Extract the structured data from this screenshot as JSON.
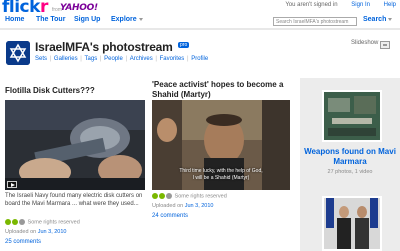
{
  "header": {
    "logo_flick": "flick",
    "logo_r": "r",
    "from": "from",
    "yahoo": "YAHOO!",
    "signin_status": "You aren't signed in",
    "sign_in": "Sign In",
    "help": "Help"
  },
  "nav": {
    "home": "Home",
    "tour": "The Tour",
    "signup": "Sign Up",
    "explore": "Explore",
    "search_placeholder": "Search IsraelMFA's photostream",
    "search": "Search"
  },
  "profile": {
    "title": "IsraelMFA's photostream",
    "pro_badge": "pro",
    "subnav": [
      "Sets",
      "Galleries",
      "Tags",
      "People",
      "Archives",
      "Favorites",
      "Profile"
    ],
    "slideshow": "Slideshow"
  },
  "posts": [
    {
      "title": "Flotilla Disk Cutters???",
      "caption": "The Israeli Navy found many electric disk cutters on board the Mavi Marmara ... what were they used...",
      "rights": "Some rights reserved",
      "uploaded_prefix": "Uploaded on",
      "uploaded_date": "Jun 3, 2010",
      "comments": "25 comments"
    },
    {
      "title": "'Peace activist' hopes to become a Shahid (Martyr)",
      "subtitle_line1": "Third time lucky, with the help of God,",
      "subtitle_line2": "I will be a Shahid (Martyr)",
      "rights": "Some rights reserved",
      "uploaded_prefix": "Uploaded on",
      "uploaded_date": "Jun 3, 2010",
      "comments": "24 comments"
    }
  ],
  "set": {
    "title": "Weapons found on Mavi Marmara",
    "meta": "27 photos, 1 video"
  }
}
